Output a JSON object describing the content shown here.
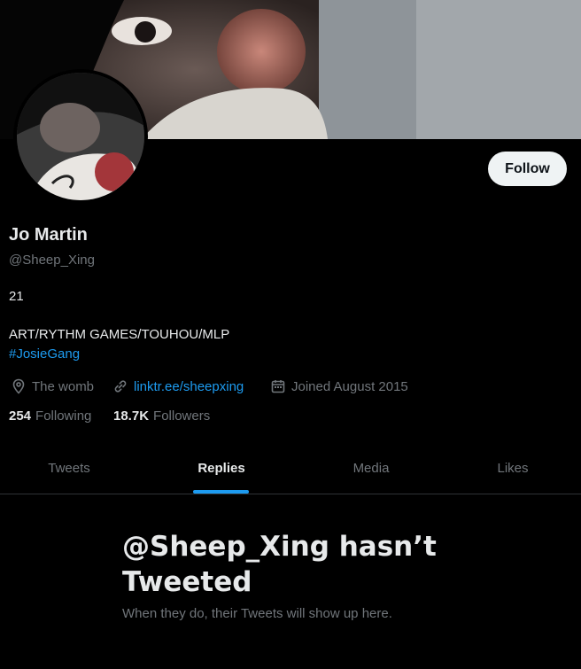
{
  "profile": {
    "name": "Jo Martin",
    "handle": "@Sheep_Xing",
    "bio_line1": "21",
    "bio_line2": "ART/RYTHM GAMES/TOUHOU/MLP",
    "hashtag": "#JosieGang",
    "location": "The womb",
    "link": "linktr.ee/sheepxing",
    "joined": "Joined August 2015"
  },
  "stats": {
    "following_count": "254",
    "following_label": "Following",
    "followers_count": "18.7K",
    "followers_label": "Followers"
  },
  "follow_button": {
    "label": "Follow"
  },
  "tabs": [
    {
      "label": "Tweets",
      "active": false
    },
    {
      "label": "Replies",
      "active": true
    },
    {
      "label": "Media",
      "active": false
    },
    {
      "label": "Likes",
      "active": false
    }
  ],
  "empty_state": {
    "title": "@Sheep_Xing hasn’t Tweeted",
    "subtitle": "When they do, their Tweets will show up here."
  },
  "icons": {
    "location": "map-pin-icon",
    "link": "link-icon",
    "joined": "calendar-icon"
  },
  "colors": {
    "background": "#000000",
    "accent": "#1d9bf0",
    "text_primary": "#e7e9ea",
    "text_secondary": "#71767b",
    "button_bg": "#eff3f4"
  }
}
